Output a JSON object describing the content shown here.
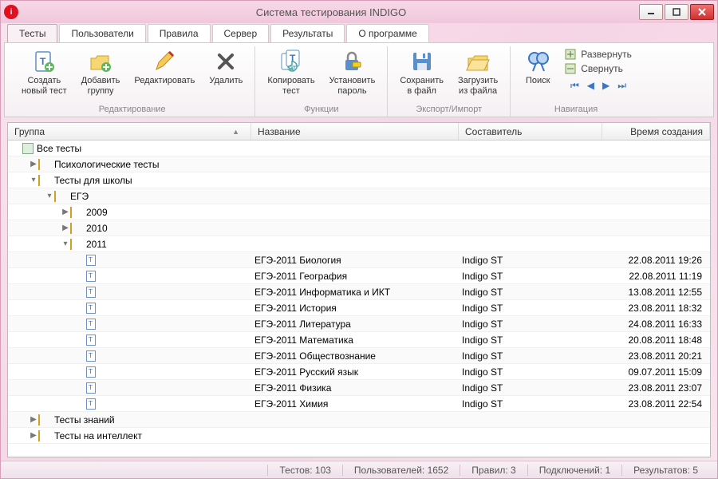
{
  "window": {
    "title": "Система тестирования INDIGO"
  },
  "tabs": [
    {
      "label": "Тесты",
      "active": true
    },
    {
      "label": "Пользователи"
    },
    {
      "label": "Правила"
    },
    {
      "label": "Сервер"
    },
    {
      "label": "Результаты"
    },
    {
      "label": "О программе"
    }
  ],
  "ribbon": {
    "groups": [
      {
        "title": "Редактирование",
        "items": [
          {
            "label": "Создать\nновый тест",
            "name": "new-test"
          },
          {
            "label": "Добавить\nгруппу",
            "name": "add-group"
          },
          {
            "label": "Редактировать",
            "name": "edit"
          },
          {
            "label": "Удалить",
            "name": "delete"
          }
        ]
      },
      {
        "title": "Функции",
        "items": [
          {
            "label": "Копировать\nтест",
            "name": "copy-test"
          },
          {
            "label": "Установить\nпароль",
            "name": "set-password"
          }
        ]
      },
      {
        "title": "Экспорт/Импорт",
        "items": [
          {
            "label": "Сохранить\nв файл",
            "name": "save-file"
          },
          {
            "label": "Загрузить\nиз файла",
            "name": "load-file"
          }
        ]
      },
      {
        "title": "Навигация",
        "items": [
          {
            "label": "Поиск",
            "name": "search"
          }
        ],
        "extra": {
          "expand": "Развернуть",
          "collapse": "Свернуть"
        }
      }
    ]
  },
  "columns": {
    "group": "Группа",
    "name": "Название",
    "author": "Составитель",
    "date": "Время создания"
  },
  "tree": [
    {
      "type": "root",
      "label": "Все тесты",
      "indent": 0
    },
    {
      "type": "folder",
      "label": "Психологические тесты",
      "indent": 1,
      "exp": "▶"
    },
    {
      "type": "folder",
      "label": "Тесты для школы",
      "indent": 1,
      "exp": "▾"
    },
    {
      "type": "folder",
      "label": "ЕГЭ",
      "indent": 2,
      "exp": "▾"
    },
    {
      "type": "folder",
      "label": "2009",
      "indent": 3,
      "exp": "▶"
    },
    {
      "type": "folder",
      "label": "2010",
      "indent": 3,
      "exp": "▶"
    },
    {
      "type": "folder",
      "label": "2011",
      "indent": 3,
      "exp": "▾"
    },
    {
      "type": "test",
      "indent": 4,
      "name": "ЕГЭ-2011 Биология",
      "author": "Indigo ST",
      "date": "22.08.2011 19:26"
    },
    {
      "type": "test",
      "indent": 4,
      "name": "ЕГЭ-2011 География",
      "author": "Indigo ST",
      "date": "22.08.2011 11:19"
    },
    {
      "type": "test",
      "indent": 4,
      "name": "ЕГЭ-2011 Информатика и ИКТ",
      "author": "Indigo ST",
      "date": "13.08.2011 12:55"
    },
    {
      "type": "test",
      "indent": 4,
      "name": "ЕГЭ-2011 История",
      "author": "Indigo ST",
      "date": "23.08.2011 18:32"
    },
    {
      "type": "test",
      "indent": 4,
      "name": "ЕГЭ-2011 Литература",
      "author": "Indigo ST",
      "date": "24.08.2011 16:33"
    },
    {
      "type": "test",
      "indent": 4,
      "name": "ЕГЭ-2011 Математика",
      "author": "Indigo ST",
      "date": "20.08.2011 18:48"
    },
    {
      "type": "test",
      "indent": 4,
      "name": "ЕГЭ-2011 Обществознание",
      "author": "Indigo ST",
      "date": "23.08.2011 20:21"
    },
    {
      "type": "test",
      "indent": 4,
      "name": "ЕГЭ-2011 Русский язык",
      "author": "Indigo ST",
      "date": "09.07.2011 15:09"
    },
    {
      "type": "test",
      "indent": 4,
      "name": "ЕГЭ-2011 Физика",
      "author": "Indigo ST",
      "date": "23.08.2011 23:07"
    },
    {
      "type": "test",
      "indent": 4,
      "name": "ЕГЭ-2011 Химия",
      "author": "Indigo ST",
      "date": "23.08.2011 22:54"
    },
    {
      "type": "folder",
      "label": "Тесты знаний",
      "indent": 1,
      "exp": "▶"
    },
    {
      "type": "folder",
      "label": "Тесты на интеллект",
      "indent": 1,
      "exp": "▶"
    }
  ],
  "status": {
    "tests": "Тестов: 103",
    "users": "Пользователей: 1652",
    "rules": "Правил: 3",
    "conns": "Подключений: 1",
    "results": "Результатов: 5"
  }
}
